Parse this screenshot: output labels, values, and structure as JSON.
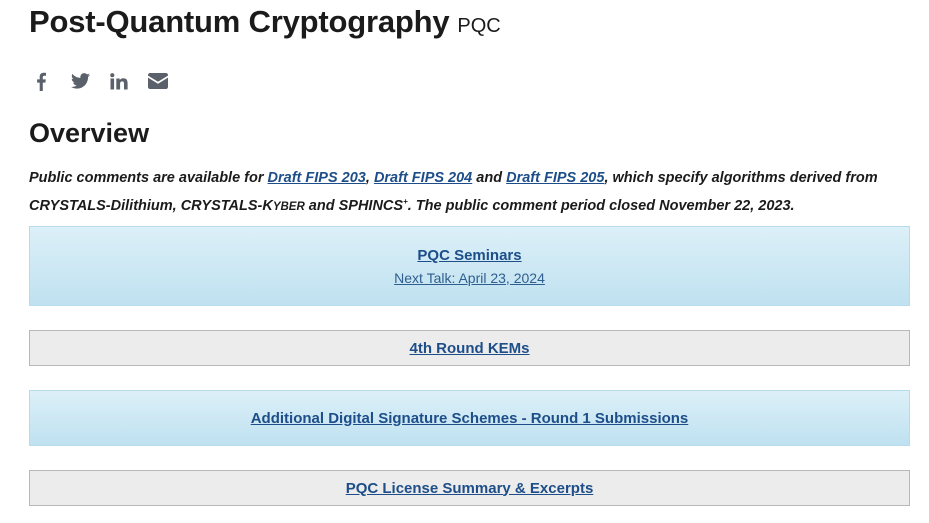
{
  "header": {
    "title": "Post-Quantum Cryptography",
    "abbr": "PQC"
  },
  "share": [
    {
      "icon": "facebook-icon"
    },
    {
      "icon": "twitter-icon"
    },
    {
      "icon": "linkedin-icon"
    },
    {
      "icon": "email-icon"
    }
  ],
  "overview": {
    "heading": "Overview",
    "notice": {
      "intro": "Public comments are available for ",
      "link1": "Draft FIPS 203",
      "sep1": ", ",
      "link2": "Draft FIPS 204",
      "sep2": " and ",
      "link3": "Draft FIPS 205",
      "mid": ", which specify algorithms derived from CRYSTALS-Dilithium, CRYSTALS-K",
      "kyber_sc": "YBER",
      "mid2": " and SPHINCS",
      "plus": "+",
      "end": ".  The public comment period closed November 22, 2023."
    }
  },
  "panels": {
    "seminars": {
      "title": "PQC Seminars",
      "subtitle": "Next Talk:  April 23, 2024"
    },
    "kems": {
      "title": "4th Round KEMs"
    },
    "signatures": {
      "title": "Additional Digital Signature Schemes - Round 1 Submissions"
    },
    "license": {
      "title": "PQC License Summary & Excerpts"
    }
  },
  "colors": {
    "link": "#1d4e89",
    "icon": "#5b616b",
    "panel_blue": "#cfe9f5",
    "panel_gray": "#ececec"
  }
}
